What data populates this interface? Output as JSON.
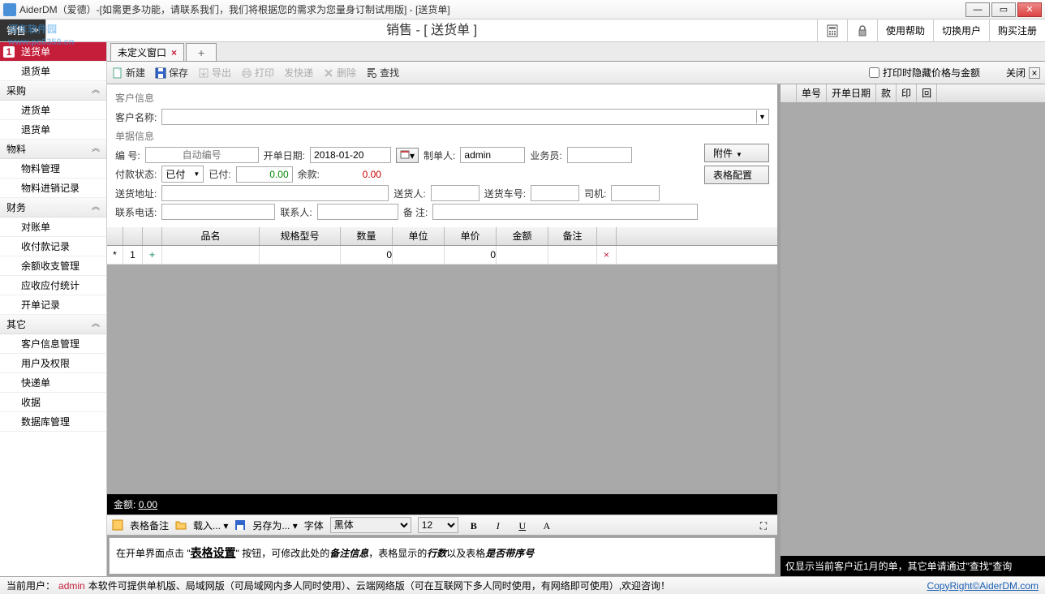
{
  "window": {
    "title": "AiderDM（爱德）-[如需更多功能，请联系我们，我们将根据您的需求为您量身订制试用版] - [送货单]"
  },
  "watermark": {
    "text": "河东软件园",
    "url": "www.pc0359.cn"
  },
  "topbar": {
    "menu": "销售",
    "center": "销售 - [ 送货单 ]",
    "help": "使用帮助",
    "switch_user": "切换用户",
    "buy": "购买注册"
  },
  "sidebar": [
    {
      "type": "item",
      "label": "送货单",
      "active": true,
      "badge": "1"
    },
    {
      "type": "item",
      "label": "退货单"
    },
    {
      "type": "cat",
      "label": "采购"
    },
    {
      "type": "item",
      "label": "进货单"
    },
    {
      "type": "item",
      "label": "退货单"
    },
    {
      "type": "cat",
      "label": "物料"
    },
    {
      "type": "item",
      "label": "物料管理"
    },
    {
      "type": "item",
      "label": "物料进销记录"
    },
    {
      "type": "cat",
      "label": "财务"
    },
    {
      "type": "item",
      "label": "对账单"
    },
    {
      "type": "item",
      "label": "收付款记录"
    },
    {
      "type": "item",
      "label": "余额收支管理"
    },
    {
      "type": "item",
      "label": "应收应付统计"
    },
    {
      "type": "item",
      "label": "开单记录"
    },
    {
      "type": "cat",
      "label": "其它"
    },
    {
      "type": "item",
      "label": "客户信息管理"
    },
    {
      "type": "item",
      "label": "用户及权限"
    },
    {
      "type": "item",
      "label": "快递单"
    },
    {
      "type": "item",
      "label": "收据"
    },
    {
      "type": "item",
      "label": "数据库管理"
    }
  ],
  "tabs": {
    "tab1": "未定义窗口"
  },
  "toolbar": {
    "new": "新建",
    "save": "保存",
    "export": "导出",
    "print": "打印",
    "express": "发快递",
    "delete": "删除",
    "find": "查找",
    "hide_price": "打印时隐藏价格与金额",
    "close": "关闭"
  },
  "form": {
    "customer_info": "客户信息",
    "customer_name_label": "客户名称:",
    "doc_info": "单据信息",
    "doc_no_label": "编    号:",
    "doc_no_placeholder": "自动编号",
    "open_date_label": "开单日期:",
    "open_date": "2018-01-20",
    "maker_label": "制单人:",
    "maker": "admin",
    "salesman_label": "业务员:",
    "attachment": "附件",
    "pay_status_label": "付款状态:",
    "pay_status": "已付",
    "paid_label": "已付:",
    "paid": "0.00",
    "balance_label": "余款:",
    "balance": "0.00",
    "table_config": "表格配置",
    "ship_addr_label": "送货地址:",
    "shipper_label": "送货人:",
    "ship_car_label": "送货车号:",
    "driver_label": "司机:",
    "phone_label": "联系电话:",
    "contact_label": "联系人:",
    "remark_label": "备    注:"
  },
  "grid": {
    "cols": [
      "",
      "",
      "",
      "品名",
      "规格型号",
      "数量",
      "单位",
      "单价",
      "金额",
      "备注",
      ""
    ],
    "widths": [
      20,
      24,
      24,
      120,
      100,
      64,
      64,
      64,
      64,
      60,
      24
    ],
    "row": {
      "star": "*",
      "idx": "1",
      "plus": "+",
      "qty": "0",
      "price": "0",
      "del": "×"
    }
  },
  "amount": {
    "label": "金额:",
    "value": "0.00"
  },
  "remark_tb": {
    "label": "表格备注",
    "load": "载入...",
    "save_as": "另存为...",
    "font_label": "字体",
    "font": "黑体",
    "size": "12"
  },
  "remark_body": {
    "t1": "在开单界面点击  \"",
    "link": "表格设置",
    "t2": "\"  按钮，可修改此处的",
    "i1": "备注信息",
    "t3": "，表格显示的",
    "i2": "行数",
    "t4": "以及表格",
    "i3": "是否带序号"
  },
  "right_panel": {
    "cols": [
      "单号",
      "开单日期",
      "款",
      "印",
      "回"
    ],
    "hint": "仅显示当前客户近1月的单，其它单请通过\"查找\"查询"
  },
  "status": {
    "prefix": "当前用户：",
    "user": "admin",
    "msg": "  本软件可提供单机版、局域网版（可局域网内多人同时使用）、云端网络版（可在互联网下多人同时使用，有网络即可使用）,欢迎咨询！",
    "copyright": "CopyRight©AiderDM.com"
  }
}
